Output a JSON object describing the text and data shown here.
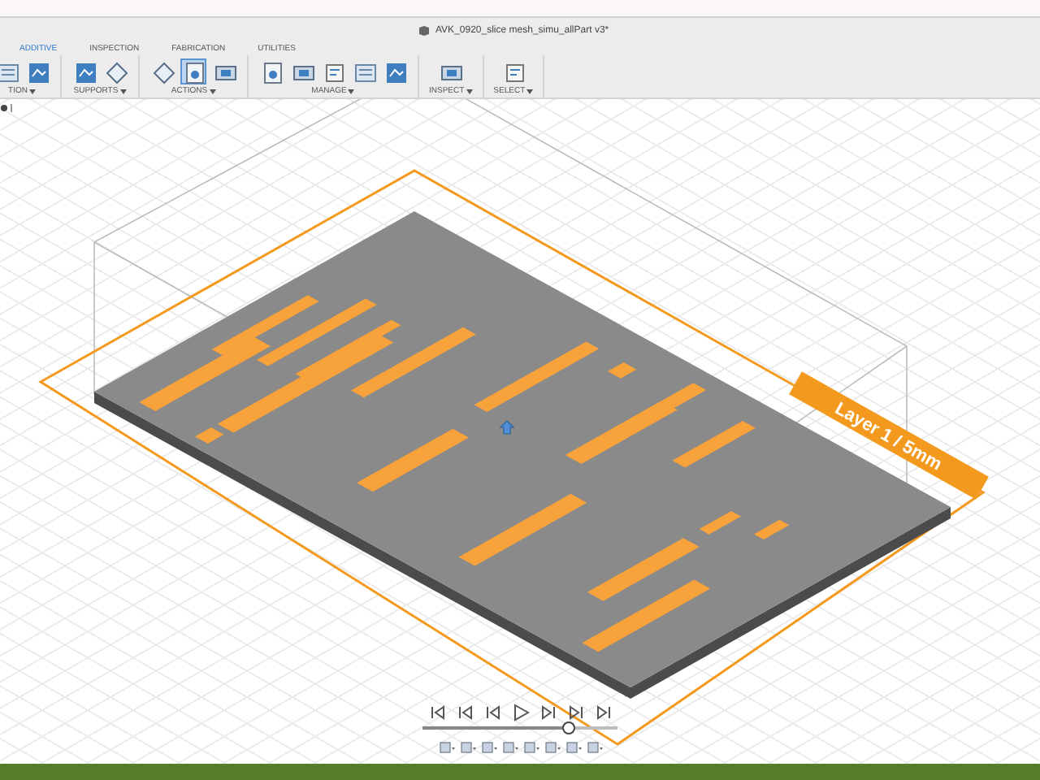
{
  "window": {
    "title": "AVK_0920_slice mesh_simu_allPart v3*"
  },
  "tabs": [
    {
      "label": "ADDITIVE",
      "selected": true
    },
    {
      "label": "INSPECTION",
      "selected": false
    },
    {
      "label": "FABRICATION",
      "selected": false
    },
    {
      "label": "UTILITIES",
      "selected": false
    }
  ],
  "toolbar": [
    {
      "label": "TION",
      "tools": [
        {
          "selected": false
        },
        {
          "selected": false
        }
      ]
    },
    {
      "label": "SUPPORTS",
      "tools": [
        {
          "selected": false
        },
        {
          "selected": false
        }
      ]
    },
    {
      "label": "ACTIONS",
      "tools": [
        {
          "selected": false
        },
        {
          "selected": true
        },
        {
          "selected": false
        }
      ]
    },
    {
      "label": "MANAGE",
      "tools": [
        {
          "selected": false
        },
        {
          "selected": false
        },
        {
          "selected": false
        },
        {
          "selected": false
        },
        {
          "selected": false
        }
      ]
    },
    {
      "label": "INSPECT",
      "tools": [
        {
          "selected": false
        }
      ]
    },
    {
      "label": "SELECT",
      "tools": [
        {
          "selected": false
        }
      ]
    }
  ],
  "viewport": {
    "layer_label": "Layer 1 / 5mm"
  },
  "timeline": {
    "level": 0.75
  }
}
